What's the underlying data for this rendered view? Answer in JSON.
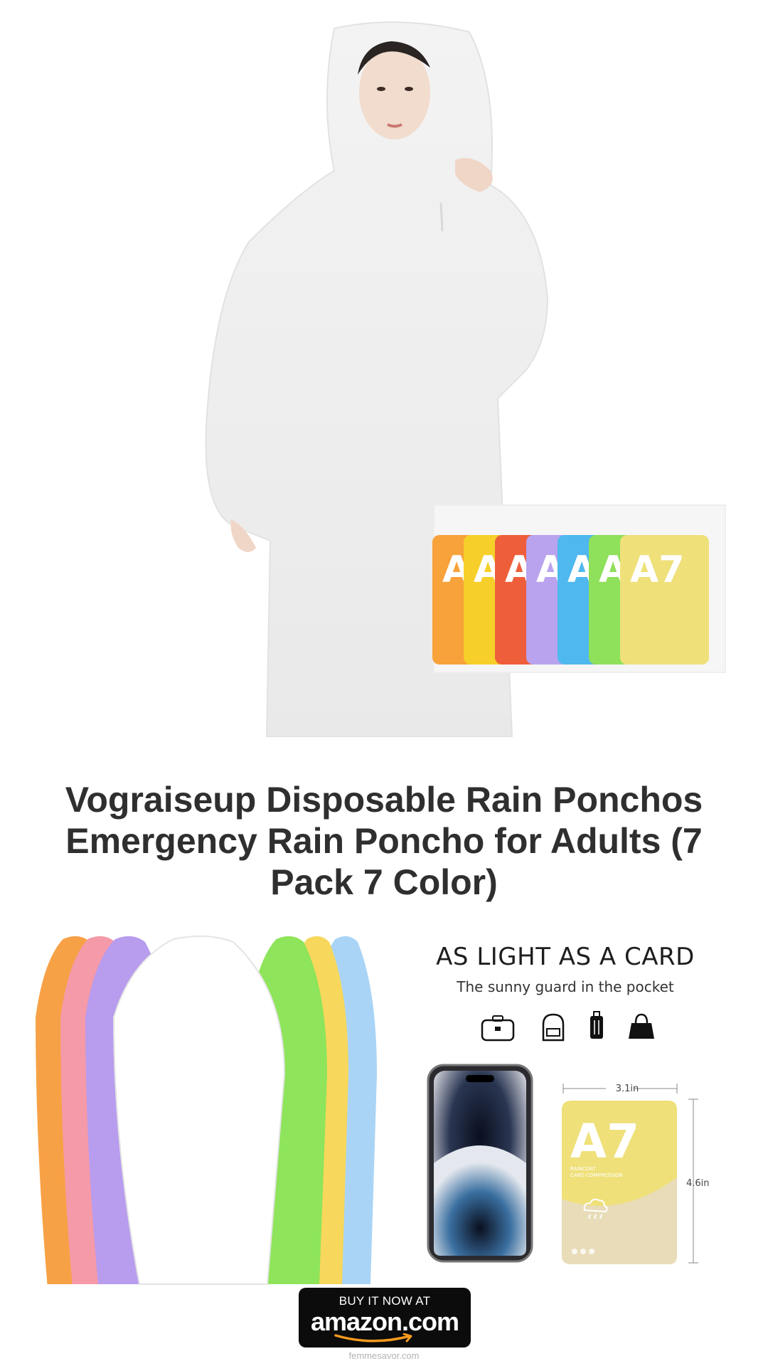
{
  "product": {
    "title": "Vograiseup Disposable Rain Ponchos Emergency Rain Poncho for Adults (7 Pack 7 Color)"
  },
  "hero": {
    "packet_labels": [
      "A",
      "A",
      "A",
      "A",
      "A",
      "A",
      "A7"
    ],
    "packet_colors": [
      "#f7a23a",
      "#f6cf2a",
      "#ef5e3a",
      "#b9a3ee",
      "#4fb8ee",
      "#8fe05a",
      "#efe07a"
    ]
  },
  "feature_card": {
    "headline": "AS LIGHT AS A CARD",
    "subhead": "The sunny guard in the pocket",
    "icons": [
      "briefcase-icon",
      "backpack-icon",
      "luggage-icon",
      "handbag-icon"
    ],
    "packet_label": "A7",
    "packet_small_text": "RAINCOAT CARD COMPRESSION",
    "width_label": "3.1in",
    "height_label": "4.6in"
  },
  "ponchos_lineup_colors": [
    "#f7a146",
    "#f59aa8",
    "#b89cee",
    "#ffffff",
    "#8ee45a",
    "#f7d75c",
    "#a9d4f6"
  ],
  "cta": {
    "line1": "BUY IT NOW AT",
    "brand": "amazon.com"
  },
  "footer": {
    "site": "femmesavor.com"
  }
}
